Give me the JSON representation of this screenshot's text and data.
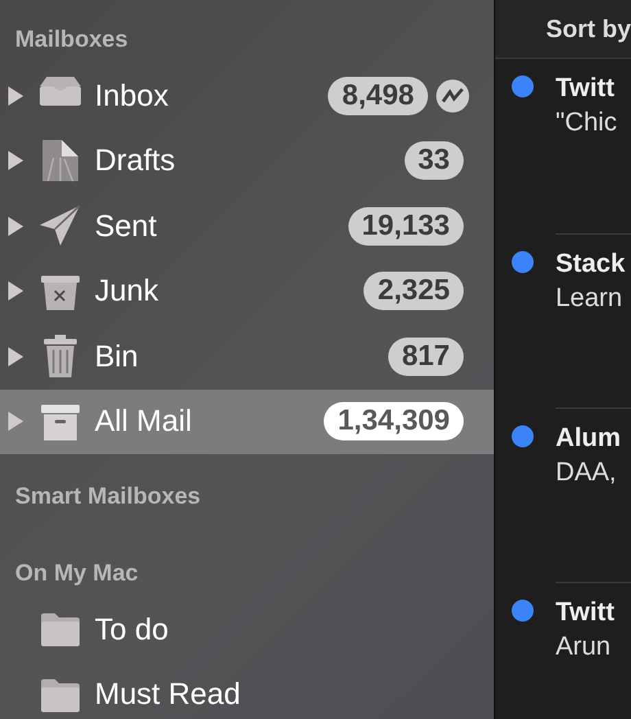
{
  "sidebar": {
    "sections": [
      {
        "title": "Mailboxes",
        "items": [
          {
            "label": "Inbox",
            "kind": "inbox",
            "count": "8,498",
            "activity": true,
            "selected": false
          },
          {
            "label": "Drafts",
            "kind": "drafts",
            "count": "33",
            "activity": false,
            "selected": false
          },
          {
            "label": "Sent",
            "kind": "sent",
            "count": "19,133",
            "activity": false,
            "selected": false
          },
          {
            "label": "Junk",
            "kind": "junk",
            "count": "2,325",
            "activity": false,
            "selected": false
          },
          {
            "label": "Bin",
            "kind": "bin",
            "count": "817",
            "activity": false,
            "selected": false
          },
          {
            "label": "All Mail",
            "kind": "archive",
            "count": "1,34,309",
            "activity": false,
            "selected": true
          }
        ]
      },
      {
        "title": "Smart Mailboxes"
      },
      {
        "title": "On My Mac",
        "items": [
          {
            "label": "To do",
            "kind": "folder",
            "selected": false
          },
          {
            "label": "Must Read",
            "kind": "folder",
            "selected": false
          }
        ]
      }
    ]
  },
  "message_list": {
    "sort_label": "Sort by",
    "messages": [
      {
        "sender": "Twitt",
        "preview": "\"Chic",
        "unread": true
      },
      {
        "sender": "Stack",
        "preview": "Learn",
        "unread": true
      },
      {
        "sender": "Alum",
        "preview": "DAA,",
        "unread": true
      },
      {
        "sender": "Twitt",
        "preview": "Arun",
        "unread": true
      }
    ]
  }
}
